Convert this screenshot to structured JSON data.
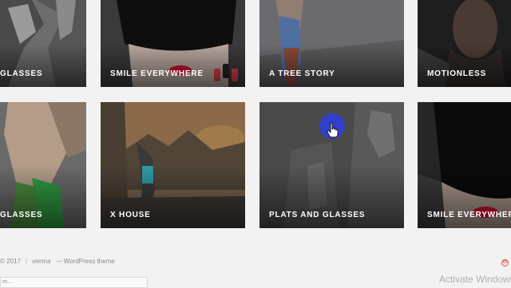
{
  "gallery": {
    "tiles": [
      {
        "label": "GLASSES"
      },
      {
        "label": "SMILE EVERYWHERE"
      },
      {
        "label": "A TREE STORY"
      },
      {
        "label": "MOTIONLESS"
      },
      {
        "label": "GLASSES"
      },
      {
        "label": "X HOUSE"
      },
      {
        "label": "PLATS AND GLASSES"
      },
      {
        "label": "SMILE EVERYWHERE"
      }
    ]
  },
  "footer": {
    "copyright": "© 2017",
    "separator": "|",
    "site_name": "vienna",
    "theme_text": "— WordPress theme",
    "field_text": "m..."
  },
  "os": {
    "watermark": "Activate Windows"
  },
  "colors": {
    "page_bg": "#f2f2f2",
    "cursor_highlight": "#2e3fd6",
    "lipstick_red": "#c8102e",
    "wordpress_icon": "#d74a3b"
  },
  "icons": {
    "cursor": "hand-pointer-icon",
    "footer_logo": "wordpress-icon"
  }
}
